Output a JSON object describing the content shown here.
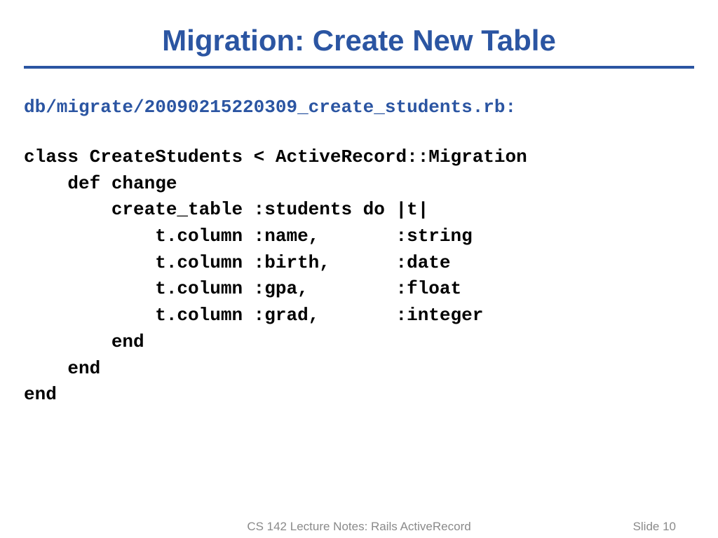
{
  "title": "Migration: Create New Table",
  "filepath": "db/migrate/20090215220309_create_students.rb:",
  "code": "class CreateStudents < ActiveRecord::Migration\n    def change\n        create_table :students do |t|\n            t.column :name,       :string\n            t.column :birth,      :date\n            t.column :gpa,        :float\n            t.column :grad,       :integer\n        end\n    end\nend",
  "footer": {
    "center": "CS 142 Lecture Notes: Rails ActiveRecord",
    "right": "Slide 10"
  }
}
